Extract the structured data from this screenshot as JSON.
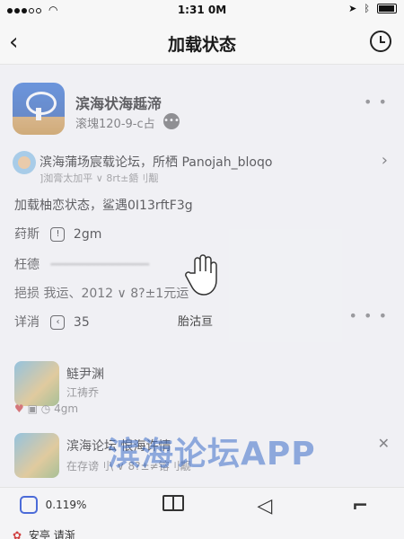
{
  "status_bar": {
    "time": "1:31 0M"
  },
  "nav": {
    "title": "加载状态"
  },
  "forum": {
    "name": "滨海状海趆渧",
    "sub": "滚塊120-9-c占"
  },
  "post": {
    "title": "滨海蒲场宸载论坛，所栖 Panojah_bloqo",
    "meta": "]洳膏太加平 ∨ 8rt±銽刂觏",
    "status_line": "加载柚恋状态，鲨遇0I13rftF3g",
    "row1_label": "荮斯",
    "row1_value": "2gm",
    "row2_label": "枉德",
    "row3_text": "挹损 我运、2012 ∨ 8?±1元运",
    "row4_label": "详消",
    "row4_value": "35"
  },
  "loading": {
    "label": "胎沽亘"
  },
  "watermark": {
    "text": "滨海论坛APP"
  },
  "reply1": {
    "title": "鲢尹渊",
    "sub": "江祷乔",
    "meta": "4gm"
  },
  "reply2": {
    "title": "滨海论坛  恨海许情",
    "sub": "在存谤刂\\ ∨ 8?±≠镕刂觏"
  },
  "tab_bar": {
    "first_value": "0.119%",
    "bottom_note": "安亭  请渐"
  }
}
